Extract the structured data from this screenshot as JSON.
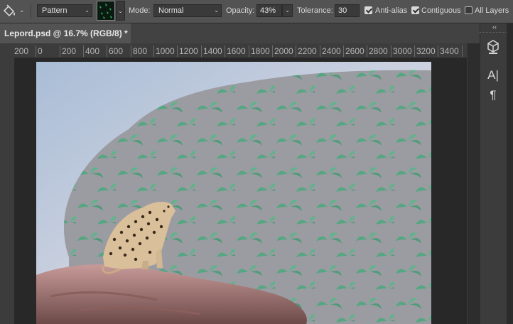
{
  "options_bar": {
    "tool_icon": "paint-bucket-icon",
    "fill_source": "Pattern",
    "mode_label": "Mode:",
    "mode_value": "Normal",
    "opacity_label": "Opacity:",
    "opacity_value": "43%",
    "tolerance_label": "Tolerance:",
    "tolerance_value": "30",
    "anti_alias_label": "Anti-alias",
    "anti_alias_checked": true,
    "contiguous_label": "Contiguous",
    "contiguous_checked": true,
    "all_layers_label": "All Layers",
    "all_layers_checked": false
  },
  "document_tab": {
    "title": "Lepord.psd @ 16.7% (RGB/8) *"
  },
  "ruler": {
    "ticks": [
      "200",
      "0",
      "200",
      "400",
      "600",
      "800",
      "1000",
      "1200",
      "1400",
      "1600",
      "1800",
      "2000",
      "2200",
      "2400",
      "2600",
      "2800",
      "3000",
      "3200",
      "3400"
    ]
  },
  "right_panel": {
    "icons": [
      "3d-cube-icon",
      "character-panel-icon",
      "paragraph-panel-icon"
    ],
    "character_glyph": "A|",
    "paragraph_glyph": "¶"
  },
  "colors": {
    "ui_background": "#535353",
    "canvas_background": "#282828",
    "pattern_leaf": "#4fa77f"
  }
}
